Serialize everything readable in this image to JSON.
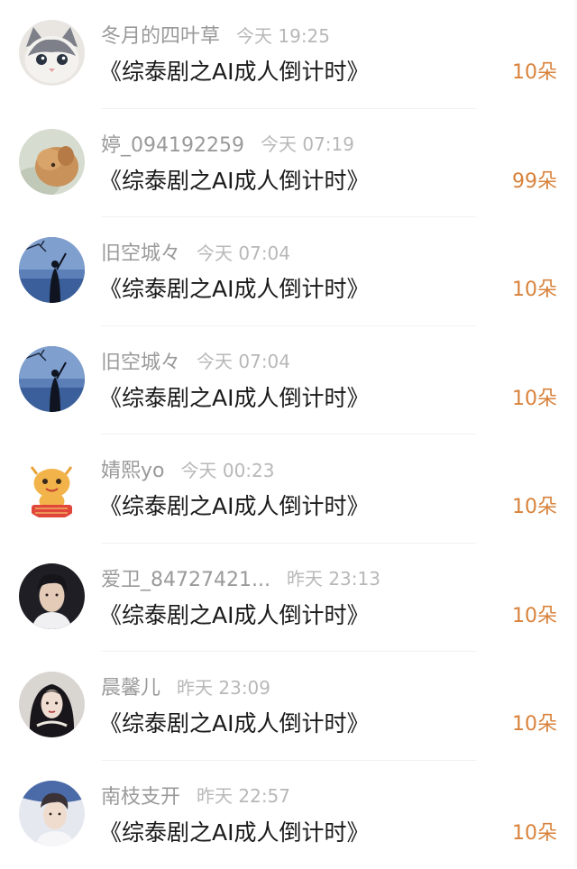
{
  "entries": [
    {
      "username": "冬月的四叶草",
      "time": "今天 19:25",
      "title": "《综泰剧之AI成人倒计时》",
      "flowers": "10朵",
      "avatar": {
        "icon": "cat-avatar-icon",
        "bg": "#e9e6e2",
        "fg": "#7d8088"
      }
    },
    {
      "username": "婷_094192259",
      "time": "今天 07:19",
      "title": "《综泰剧之AI成人倒计时》",
      "flowers": "99朵",
      "avatar": {
        "icon": "dog-avatar-icon",
        "bg": "#d6dccf",
        "fg": "#c8925a"
      }
    },
    {
      "username": "旧空城々",
      "time": "今天 07:04",
      "title": "《综泰剧之AI成人倒计时》",
      "flowers": "10朵",
      "avatar": {
        "icon": "silhouette-sky-avatar-icon",
        "bg": "#3b5f9a",
        "fg": "#0f1420"
      }
    },
    {
      "username": "旧空城々",
      "time": "今天 07:04",
      "title": "《综泰剧之AI成人倒计时》",
      "flowers": "10朵",
      "avatar": {
        "icon": "silhouette-sky-avatar-icon",
        "bg": "#3b5f9a",
        "fg": "#0f1420"
      }
    },
    {
      "username": "婧熙yo",
      "time": "今天 00:23",
      "title": "《综泰剧之AI成人倒计时》",
      "flowers": "10朵",
      "avatar": {
        "icon": "dragon-cartoon-avatar-icon",
        "bg": "#ffffff",
        "fg": "#e8a23a"
      }
    },
    {
      "username": "爱卫_84727421...",
      "time": "昨天 23:13",
      "title": "《综泰剧之AI成人倒计时》",
      "flowers": "10朵",
      "avatar": {
        "icon": "man-portrait-avatar-icon",
        "bg": "#1e1e24",
        "fg": "#e3cbb8"
      }
    },
    {
      "username": "晨馨儿",
      "time": "昨天 23:09",
      "title": "《综泰剧之AI成人倒计时》",
      "flowers": "10朵",
      "avatar": {
        "icon": "woman-portrait-avatar-icon",
        "bg": "#d9d6d2",
        "fg": "#18161a"
      }
    },
    {
      "username": "南枝支开",
      "time": "昨天 22:57",
      "title": "《综泰剧之AI成人倒计时》",
      "flowers": "10朵",
      "avatar": {
        "icon": "man-portrait-light-avatar-icon",
        "bg": "#e5e9ef",
        "fg": "#3a3236"
      }
    }
  ],
  "colors": {
    "username": "#9a9a9a",
    "time": "#b8b8b8",
    "title": "#1a1a1a",
    "flowers": "#d9823b",
    "divider": "#f1f1f1"
  }
}
